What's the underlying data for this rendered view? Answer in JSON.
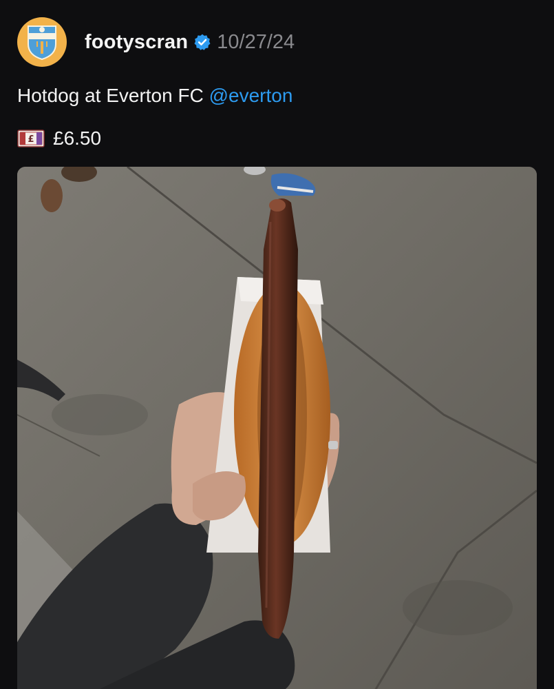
{
  "post": {
    "avatar_icon": "footy-scran-badge-icon",
    "username": "footyscran",
    "verified_icon": "verified-badge-icon",
    "date": "10/27/24",
    "caption_text": "Hotdog at Everton FC ",
    "mention": "@everton",
    "price_icon": "pound-banknote-icon",
    "price": "£6.50",
    "photo": "hotdog-photo",
    "colors": {
      "background": "#0e0e10",
      "text": "#f3f3f3",
      "mention": "#2d9bf0",
      "date": "#8a8a8e",
      "verified": "#2d9bf0",
      "avatar": "#f2b24a"
    }
  }
}
